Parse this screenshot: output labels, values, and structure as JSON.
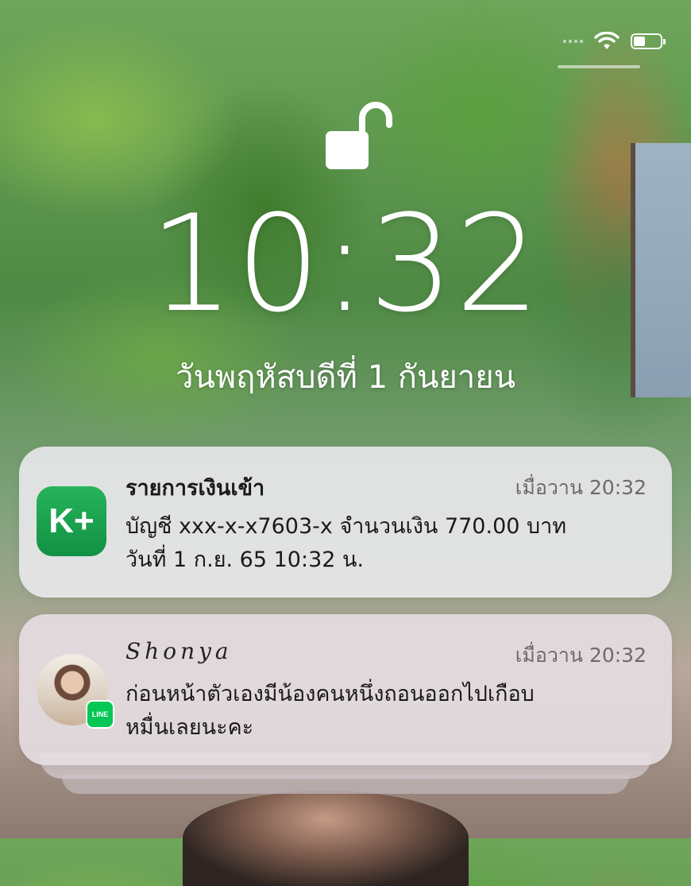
{
  "status_bar": {
    "wifi_icon": "wifi-icon",
    "battery_icon": "battery-icon"
  },
  "lock_screen": {
    "lock_icon": "unlocked-padlock-icon",
    "time": "10:32",
    "date": "วันพฤหัสบดีที่ 1 กันยายน"
  },
  "notifications": [
    {
      "app_icon": "kplus-app-icon",
      "app_icon_text": "K+",
      "title": "รายการเงินเข้า",
      "time": "เมื่อวาน 20:32",
      "body": "บัญชี xxx-x-x7603-x  จำนวนเงิน 770.00 บาท\nวันที่ 1 ก.ย. 65  10:32 น.",
      "accent": "#1fa552"
    },
    {
      "app_icon": "avatar",
      "badge_icon": "line-app-icon",
      "badge_text": "LINE",
      "title": "Shonya",
      "time": "เมื่อวาน 20:32",
      "body": "ก่อนหน้าตัวเองมีน้องคนหนึ่งถอนออกไปเกือบ\nหมื่นเลยนะคะ",
      "accent": "#06c755"
    }
  ]
}
